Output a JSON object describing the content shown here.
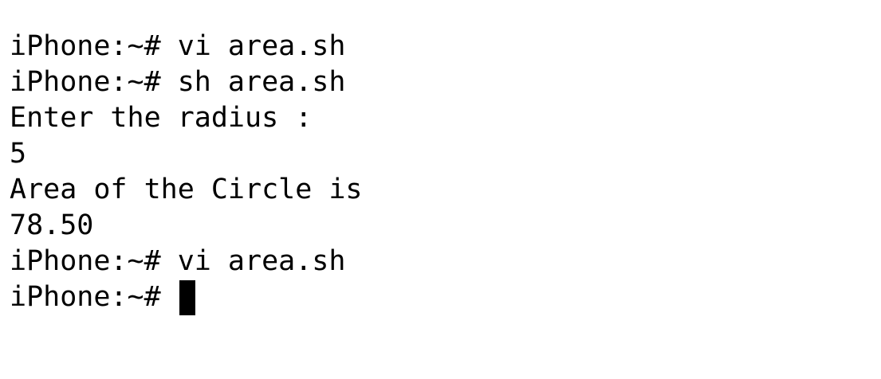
{
  "terminal": {
    "lines": [
      {
        "prompt": "iPhone:~# ",
        "command": "vi area.sh"
      },
      {
        "prompt": "iPhone:~# ",
        "command": "sh area.sh"
      },
      {
        "output": "Enter the radius :"
      },
      {
        "output": "5"
      },
      {
        "output": "Area of the Circle is"
      },
      {
        "output": "78.50"
      },
      {
        "prompt": "iPhone:~# ",
        "command": "vi area.sh"
      },
      {
        "prompt": "iPhone:~# ",
        "command": ""
      }
    ]
  }
}
